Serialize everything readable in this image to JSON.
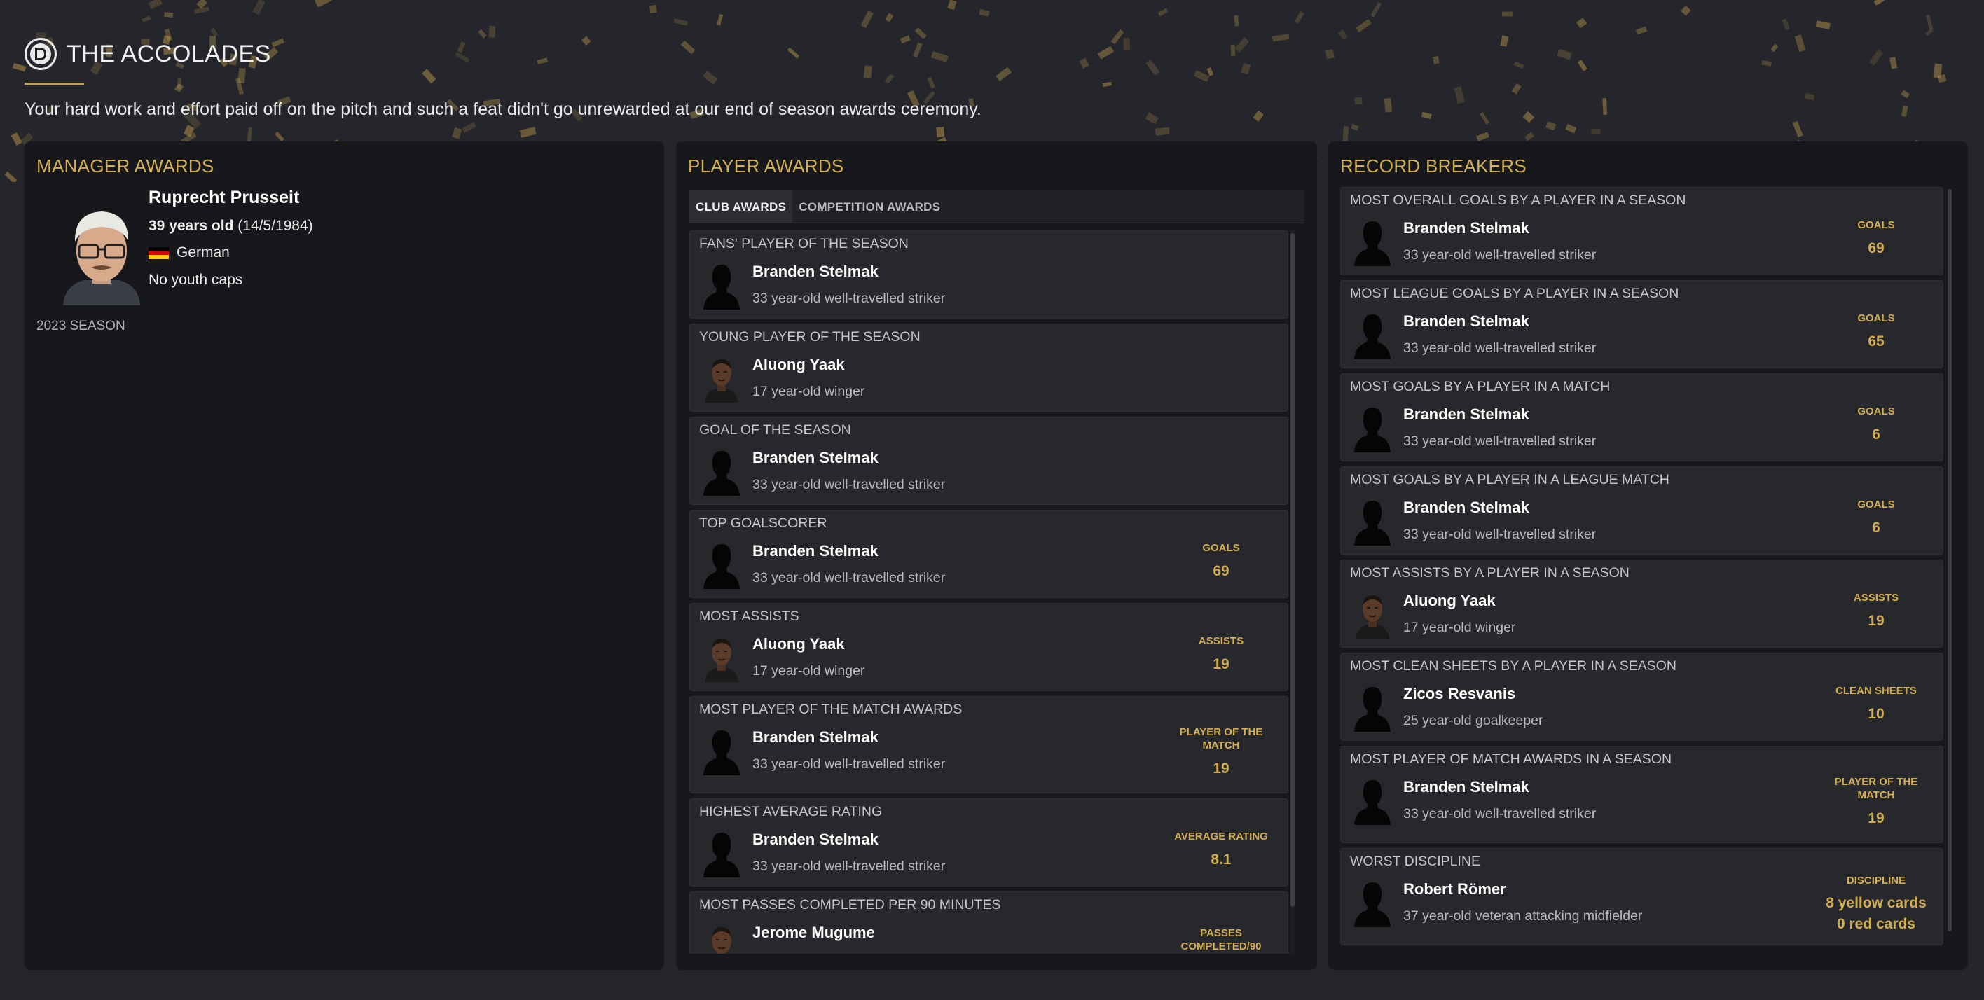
{
  "header": {
    "logo_icon": "club-crest-icon",
    "title": "THE ACCOLADES",
    "intro": "Your hard work and effort paid off on the pitch and such a feat didn't go unrewarded at our end of season awards ceremony."
  },
  "colors": {
    "accent": "#d2ad52",
    "panel": "#17181c",
    "card": "#26282c",
    "background": "#24262b"
  },
  "manager_awards": {
    "title": "MANAGER AWARDS",
    "name": "Ruprecht Prusseit",
    "age": "39 years old",
    "dob": "(14/5/1984)",
    "nationality": "German",
    "flag_icon": "germany-flag-icon",
    "caps": "No youth caps",
    "season": "2023 SEASON"
  },
  "player_awards": {
    "title": "PLAYER AWARDS",
    "tabs": [
      {
        "label": "CLUB AWARDS",
        "active": true
      },
      {
        "label": "COMPETITION AWARDS",
        "active": false
      }
    ],
    "cards": [
      {
        "award": "FANS' PLAYER OF THE SEASON",
        "player": "Branden Stelmak",
        "desc": "33 year-old well-travelled striker",
        "avatar": "silhouette",
        "stat_label": "",
        "stat_value": ""
      },
      {
        "award": "YOUNG PLAYER OF THE SEASON",
        "player": "Aluong Yaak",
        "desc": "17 year-old winger",
        "avatar": "face",
        "stat_label": "",
        "stat_value": ""
      },
      {
        "award": "GOAL OF THE SEASON",
        "player": "Branden Stelmak",
        "desc": "33 year-old well-travelled striker",
        "avatar": "silhouette",
        "stat_label": "",
        "stat_value": ""
      },
      {
        "award": "TOP GOALSCORER",
        "player": "Branden Stelmak",
        "desc": "33 year-old well-travelled striker",
        "avatar": "silhouette",
        "stat_label": "GOALS",
        "stat_value": "69"
      },
      {
        "award": "MOST ASSISTS",
        "player": "Aluong Yaak",
        "desc": "17 year-old winger",
        "avatar": "face",
        "stat_label": "ASSISTS",
        "stat_value": "19"
      },
      {
        "award": "MOST PLAYER OF THE MATCH AWARDS",
        "player": "Branden Stelmak",
        "desc": "33 year-old well-travelled striker",
        "avatar": "silhouette",
        "stat_label": "PLAYER OF THE MATCH",
        "stat_value": "19",
        "tall": true
      },
      {
        "award": "HIGHEST AVERAGE RATING",
        "player": "Branden Stelmak",
        "desc": "33 year-old well-travelled striker",
        "avatar": "silhouette",
        "stat_label": "AVERAGE RATING",
        "stat_value": "8.1"
      },
      {
        "award": "MOST PASSES COMPLETED PER 90 MINUTES",
        "player": "Jerome Mugume",
        "desc": "",
        "avatar": "face",
        "stat_label": "PASSES COMPLETED/90",
        "stat_value": ""
      }
    ]
  },
  "record_breakers": {
    "title": "RECORD BREAKERS",
    "cards": [
      {
        "award": "MOST OVERALL GOALS BY A PLAYER IN A SEASON",
        "player": "Branden Stelmak",
        "desc": "33 year-old well-travelled striker",
        "avatar": "silhouette",
        "stat_label": "GOALS",
        "stat_value": "69"
      },
      {
        "award": "MOST LEAGUE GOALS BY A PLAYER IN A SEASON",
        "player": "Branden Stelmak",
        "desc": "33 year-old well-travelled striker",
        "avatar": "silhouette",
        "stat_label": "GOALS",
        "stat_value": "65"
      },
      {
        "award": "MOST GOALS BY A PLAYER IN A MATCH",
        "player": "Branden Stelmak",
        "desc": "33 year-old well-travelled striker",
        "avatar": "silhouette",
        "stat_label": "GOALS",
        "stat_value": "6"
      },
      {
        "award": "MOST GOALS BY A PLAYER IN A LEAGUE MATCH",
        "player": "Branden Stelmak",
        "desc": "33 year-old well-travelled striker",
        "avatar": "silhouette",
        "stat_label": "GOALS",
        "stat_value": "6"
      },
      {
        "award": "MOST ASSISTS BY A PLAYER IN A SEASON",
        "player": "Aluong Yaak",
        "desc": "17 year-old winger",
        "avatar": "face",
        "stat_label": "ASSISTS",
        "stat_value": "19"
      },
      {
        "award": "MOST CLEAN SHEETS BY A PLAYER IN A SEASON",
        "player": "Zicos Resvanis",
        "desc": "25 year-old goalkeeper",
        "avatar": "silhouette",
        "stat_label": "CLEAN SHEETS",
        "stat_value": "10"
      },
      {
        "award": "MOST PLAYER OF MATCH AWARDS IN A SEASON",
        "player": "Branden Stelmak",
        "desc": "33 year-old well-travelled striker",
        "avatar": "silhouette",
        "stat_label": "PLAYER OF THE MATCH",
        "stat_value": "19",
        "tall": true
      },
      {
        "award": "WORST DISCIPLINE",
        "player": "Robert Römer",
        "desc": "37 year-old veteran attacking midfielder",
        "avatar": "silhouette",
        "stat_label": "DISCIPLINE",
        "stat_value": "8 yellow cards\n0 red cards",
        "tall": true
      }
    ]
  }
}
